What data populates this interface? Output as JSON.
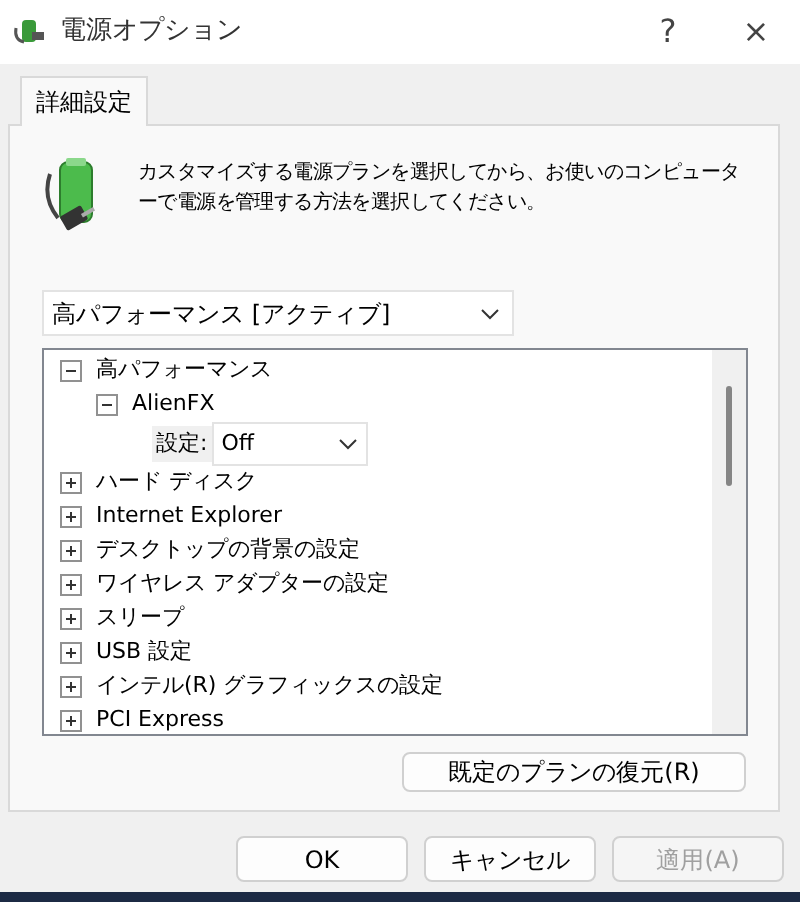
{
  "window": {
    "title": "電源オプション",
    "help": "?",
    "close": "×"
  },
  "tabs": [
    {
      "label": "詳細設定",
      "selected": true
    }
  ],
  "description": "カスタマイズする電源プランを選択してから、お使いのコンピューターで電源を管理する方法を選択してください。",
  "plan_select": {
    "value": "高パフォーマンス [アクティブ]"
  },
  "tree": [
    {
      "kind": "node",
      "label": "高パフォーマンス",
      "expanded": true,
      "children": [
        {
          "kind": "node",
          "label": "AlienFX",
          "expanded": true,
          "children": [
            {
              "kind": "setting",
              "label": "設定:",
              "value": "Off"
            }
          ]
        }
      ]
    },
    {
      "kind": "node",
      "label": "ハード ディスク",
      "expanded": false
    },
    {
      "kind": "node",
      "label": "Internet Explorer",
      "expanded": false
    },
    {
      "kind": "node",
      "label": "デスクトップの背景の設定",
      "expanded": false
    },
    {
      "kind": "node",
      "label": "ワイヤレス アダプターの設定",
      "expanded": false
    },
    {
      "kind": "node",
      "label": "スリープ",
      "expanded": false
    },
    {
      "kind": "node",
      "label": "USB 設定",
      "expanded": false
    },
    {
      "kind": "node",
      "label": "インテル(R) グラフィックスの設定",
      "expanded": false
    },
    {
      "kind": "node",
      "label": "PCI Express",
      "expanded": false
    }
  ],
  "restore_button": {
    "label": "既定のプランの復元(R)"
  },
  "buttons": [
    {
      "label": "OK",
      "disabled": false
    },
    {
      "label": "キャンセル",
      "disabled": false
    },
    {
      "label": "適用(A)",
      "disabled": true
    }
  ]
}
